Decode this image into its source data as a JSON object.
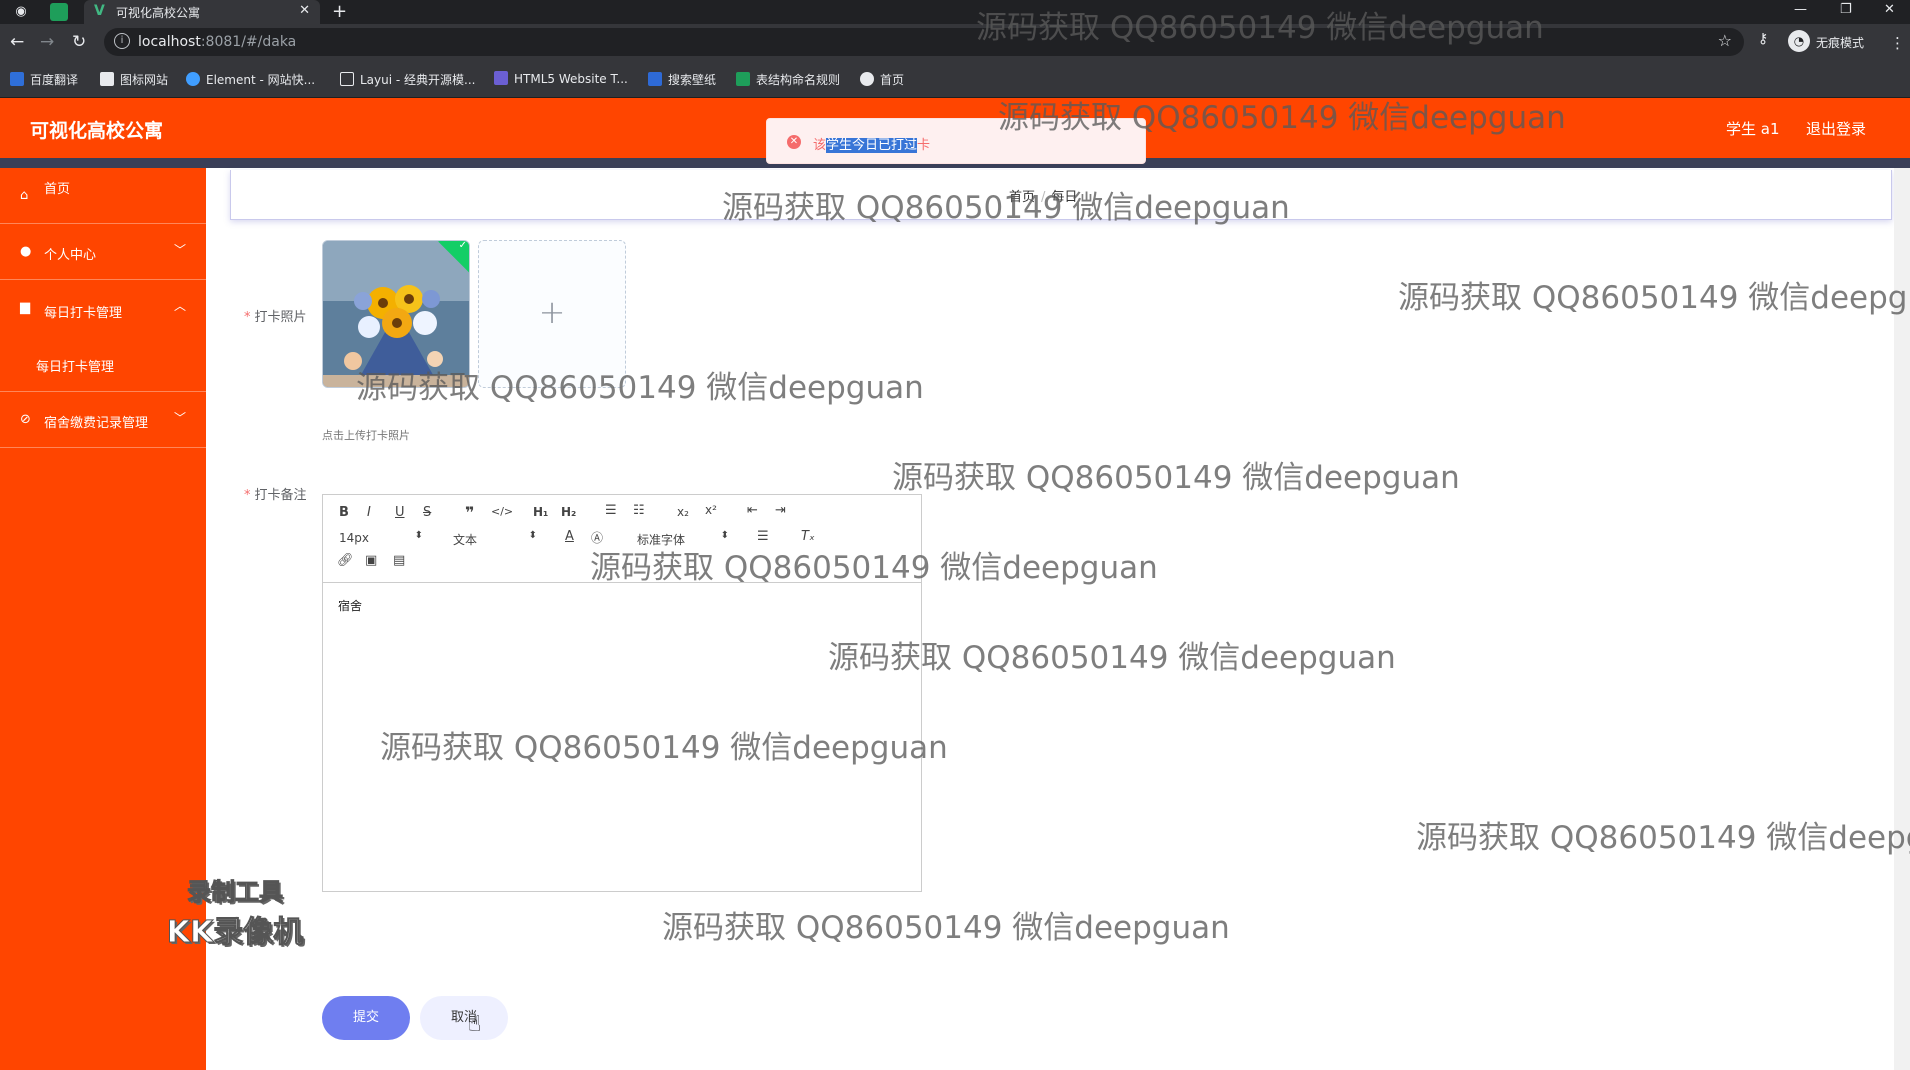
{
  "browser": {
    "tab_title": "可视化高校公寓",
    "url_host": "localhost",
    "url_rest": ":8081/#/daka",
    "incognito_label": "无痕模式",
    "bookmarks": [
      "百度翻译",
      "图标网站",
      "Element - 网站快...",
      "Layui - 经典开源模...",
      "HTML5 Website T...",
      "搜索壁纸",
      "表结构命名规则",
      "首页"
    ]
  },
  "header": {
    "title": "可视化高校公寓",
    "user": "学生 a1",
    "logout": "退出登录"
  },
  "toast": {
    "prefix": "该",
    "selected": "学生今日已打过",
    "suffix": "卡",
    "color": "#f56c6c"
  },
  "sidebar": {
    "items": [
      {
        "label": "首页",
        "icon": "home-icon"
      },
      {
        "label": "个人中心",
        "icon": "user-icon"
      },
      {
        "label": "每日打卡管理",
        "icon": "briefcase-icon"
      },
      {
        "label": "每日打卡管理",
        "icon": ""
      },
      {
        "label": "宿舍缴费记录管理",
        "icon": "circle-slash-icon"
      }
    ],
    "accent": "#ff4500"
  },
  "breadcrumb": {
    "home": "首页",
    "current": "每日"
  },
  "form": {
    "photo_label": "打卡照片",
    "upload_tip": "点击上传打卡照片",
    "note_label": "打卡备注",
    "editor": {
      "font_size": "14px",
      "block_format": "文本",
      "font_family": "标准字体",
      "content": "宿舍"
    },
    "submit_label": "提交",
    "cancel_label": "取消",
    "submit_color": "#6f7ef0"
  },
  "watermark": {
    "text": "源码获取 QQ86050149 微信deepguan",
    "text_cut1": "源码获取 QQ86050149 微信deepgua",
    "text_cut2": "源码获取 QQ86050149 微信deepgu"
  },
  "recorder": {
    "line1": "录制工具",
    "line2": "KK录像机"
  }
}
